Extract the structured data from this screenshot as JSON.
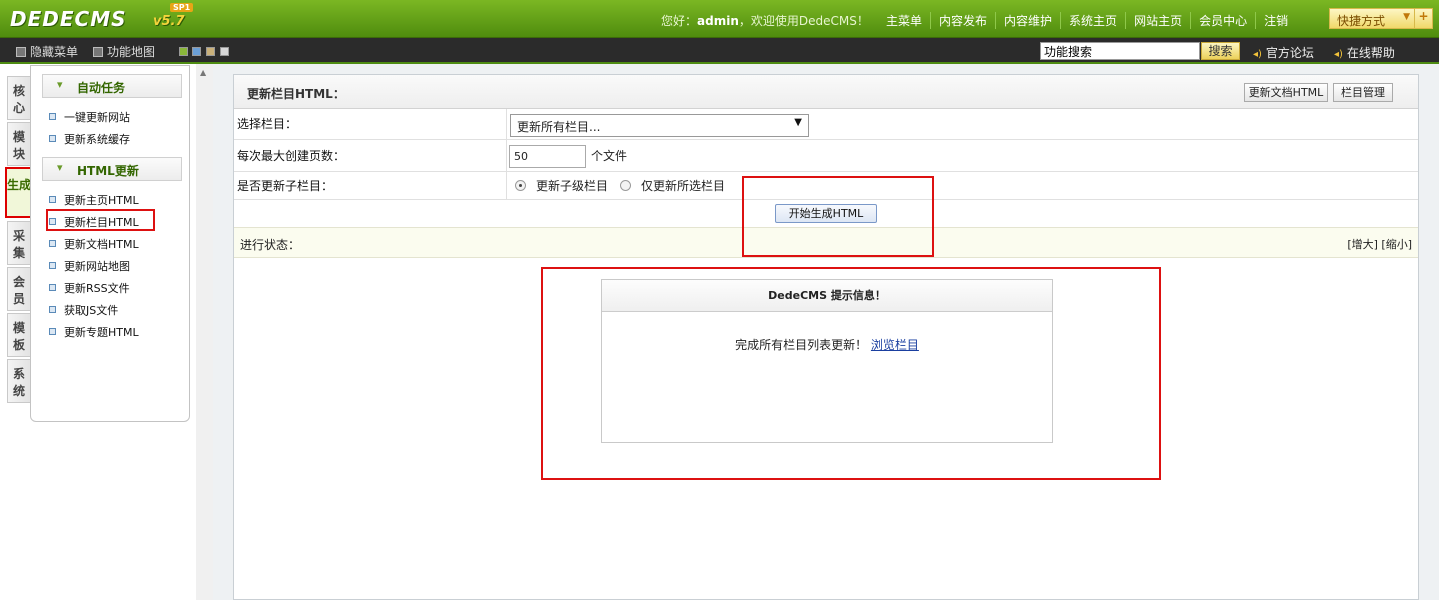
{
  "header": {
    "logo_text": "DEDECMS",
    "logo_version": "v5.7",
    "logo_sp": "SP1",
    "welcome_prefix": "您好：",
    "username": "admin",
    "welcome_suffix": "，欢迎使用DedeCMS！",
    "nav": [
      "主菜单",
      "内容发布",
      "内容维护",
      "系统主页",
      "网站主页",
      "会员中心",
      "注销"
    ],
    "quick_label": "快捷方式",
    "quick_dropdown_icon": "▼",
    "quick_plus": "+"
  },
  "subbar": {
    "hide_menu": "隐藏菜单",
    "function_map": "功能地图",
    "search_value": "功能搜索",
    "search_button": "搜索",
    "forum_link": "官方论坛",
    "help_link": "在线帮助",
    "link_icon": "speaker-icon",
    "swatch_colors": [
      "#8ab63a",
      "#6b9fd6",
      "#c9b07a",
      "#d8d8d8"
    ]
  },
  "left_tabs": [
    {
      "label": "核心",
      "active": false
    },
    {
      "label": "模块",
      "active": false
    },
    {
      "label": "生成",
      "active": true
    },
    {
      "label": "采集",
      "active": false
    },
    {
      "label": "会员",
      "active": false
    },
    {
      "label": "模板",
      "active": false
    },
    {
      "label": "系统",
      "active": false
    }
  ],
  "side_menu": {
    "groups": [
      {
        "title": "自动任务",
        "items": [
          "一键更新网站",
          "更新系统缓存"
        ]
      },
      {
        "title": "HTML更新",
        "items": [
          "更新主页HTML",
          "更新栏目HTML",
          "更新文档HTML",
          "更新网站地图",
          "更新RSS文件",
          "获取JS文件",
          "更新专题HTML"
        ]
      }
    ],
    "active_item": "更新栏目HTML"
  },
  "main": {
    "title": "更新栏目HTML：",
    "btn_update_docs": "更新文档HTML",
    "btn_category_manage": "栏目管理",
    "row_select_label": "选择栏目：",
    "select_value": "更新所有栏目...",
    "row_pages_label": "每次最大创建页数：",
    "pages_value": "50",
    "pages_unit": "个文件",
    "row_sub_label": "是否更新子栏目：",
    "radio_sub": "更新子级栏目",
    "radio_only": "仅更新所选栏目",
    "radio_selected": "更新子级栏目",
    "start_button": "开始生成HTML",
    "progress_label": "进行状态：",
    "enlarge": "[增大]",
    "shrink": "[缩小]"
  },
  "message": {
    "title": "DedeCMS 提示信息！",
    "body": "完成所有栏目列表更新！",
    "link": "浏览栏目"
  },
  "colors": {
    "brand_green": "#5a9a14",
    "highlight_red": "#d11111",
    "link_blue": "#1a3fa0"
  }
}
